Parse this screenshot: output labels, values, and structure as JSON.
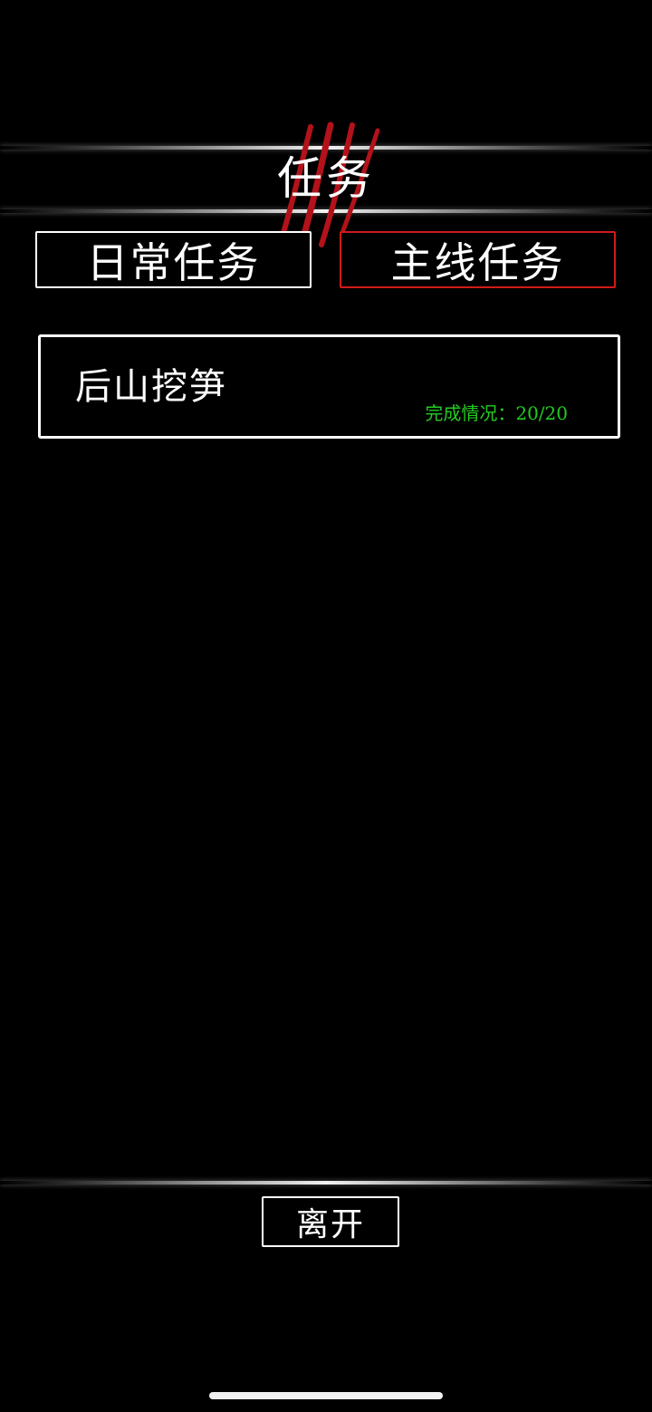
{
  "header": {
    "title": "任务"
  },
  "tabs": [
    {
      "label": "日常任务",
      "selected": false
    },
    {
      "label": "主线任务",
      "selected": true
    }
  ],
  "tasks": [
    {
      "name": "后山挖笋",
      "progress": "完成情况：20/20"
    }
  ],
  "footer": {
    "leave_label": "离开"
  },
  "colors": {
    "background": "#000000",
    "selected_tab_border": "#d11a1a",
    "progress_text": "#22cc22",
    "claw_mark": "#b3121a"
  },
  "icons": {
    "title_decoration": "claw-mark-icon"
  }
}
